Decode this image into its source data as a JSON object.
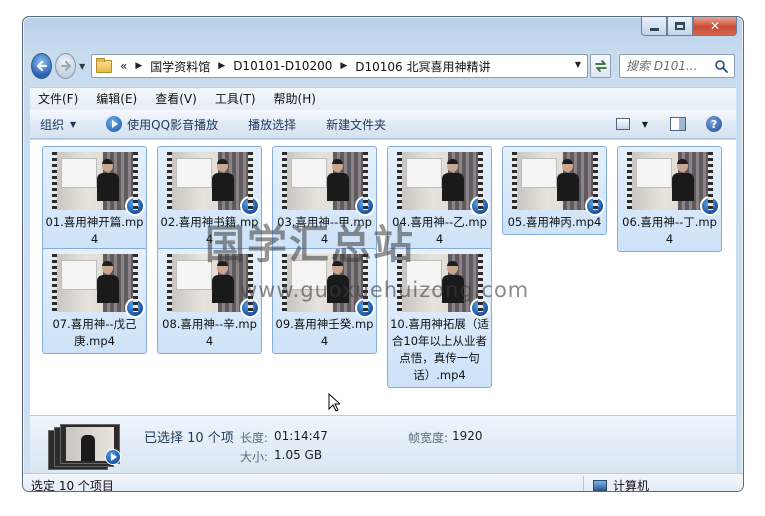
{
  "window": {
    "caption": {
      "minimize": "minimize",
      "maximize": "maximize",
      "close": "close"
    }
  },
  "address": {
    "overflow": "«",
    "crumbs": [
      "国学资料馆",
      "D10101-D10200",
      "D10106 北冥喜用神精讲"
    ]
  },
  "search": {
    "placeholder": "搜索 D101..."
  },
  "menu": [
    "文件(F)",
    "编辑(E)",
    "查看(V)",
    "工具(T)",
    "帮助(H)"
  ],
  "toolbar": {
    "organize": "组织",
    "play_qq": "使用QQ影音播放",
    "play_selection": "播放选择",
    "new_folder": "新建文件夹"
  },
  "files": [
    {
      "name": "01.喜用神开篇.mp4"
    },
    {
      "name": "02.喜用神书籍.mp4"
    },
    {
      "name": "03.喜用神--甲.mp4"
    },
    {
      "name": "04.喜用神--乙.mp4"
    },
    {
      "name": "05.喜用神丙.mp4"
    },
    {
      "name": "06.喜用神--丁.mp4"
    },
    {
      "name": "07.喜用神--戊己庚.mp4"
    },
    {
      "name": "08.喜用神--辛.mp4"
    },
    {
      "name": "09.喜用神壬癸.mp4"
    },
    {
      "name": "10.喜用神拓展（适合10年以上从业者点悟，真传一句话）.mp4"
    }
  ],
  "watermark": {
    "text": "国学汇总站",
    "url": "www.guoxuehuizong.com"
  },
  "details": {
    "selected": "已选择 10 个项",
    "length_label": "长度:",
    "length_value": "01:14:47",
    "size_label": "大小:",
    "size_value": "1.05 GB",
    "width_label": "帧宽度:",
    "width_value": "1920"
  },
  "status": {
    "text": "选定 10 个项目",
    "location": "计算机"
  }
}
